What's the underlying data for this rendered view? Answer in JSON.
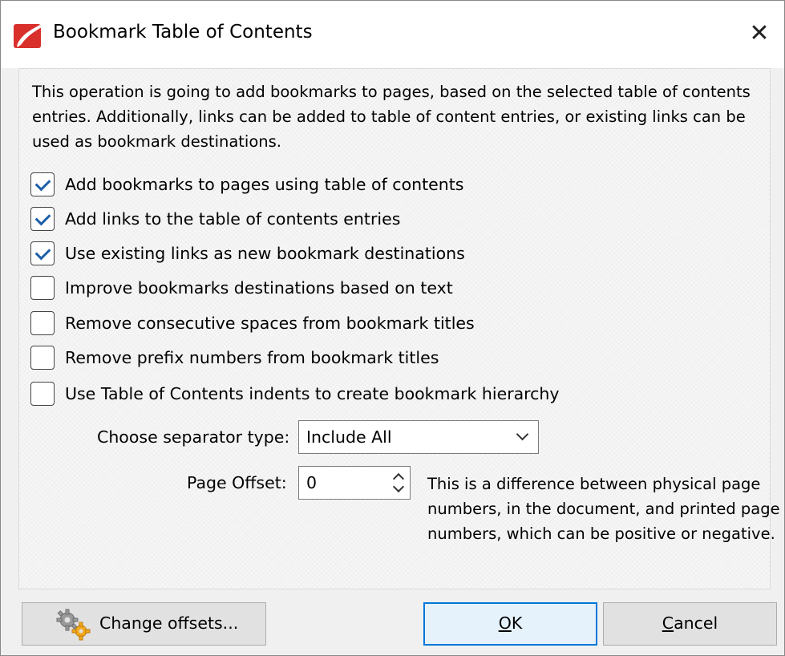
{
  "window": {
    "title": "Bookmark Table of Contents",
    "icon": "pdf-app-icon",
    "close_icon": "close-icon"
  },
  "description": "This operation is going to add bookmarks to pages, based on the selected table of contents entries. Additionally, links can be added to table of content entries, or existing links can be used as bookmark destinations.",
  "options": [
    {
      "label": "Add bookmarks to pages using table of contents",
      "checked": true
    },
    {
      "label": "Add links to the table of contents entries",
      "checked": true
    },
    {
      "label": "Use existing links as new bookmark destinations",
      "checked": true
    },
    {
      "label": "Improve bookmarks destinations based on text",
      "checked": false
    },
    {
      "label": "Remove consecutive spaces from bookmark titles",
      "checked": false
    },
    {
      "label": "Remove prefix numbers from bookmark titles",
      "checked": false
    },
    {
      "label": "Use Table of Contents indents to create bookmark hierarchy",
      "checked": false
    }
  ],
  "separator": {
    "label": "Choose separator type:",
    "value": "Include All"
  },
  "page_offset": {
    "label": "Page Offset:",
    "value": "0",
    "help": "This is a difference between physical page numbers, in the document, and printed page numbers, which can be positive or negative."
  },
  "buttons": {
    "change_offsets": "Change offsets...",
    "ok_mnemonic": "O",
    "ok_rest": "K",
    "cancel_mnemonic": "C",
    "cancel_rest": "ancel"
  },
  "colors": {
    "check_accent": "#1e5fa8",
    "default_button_border": "#0078d7",
    "app_icon_red": "#d9302c"
  }
}
